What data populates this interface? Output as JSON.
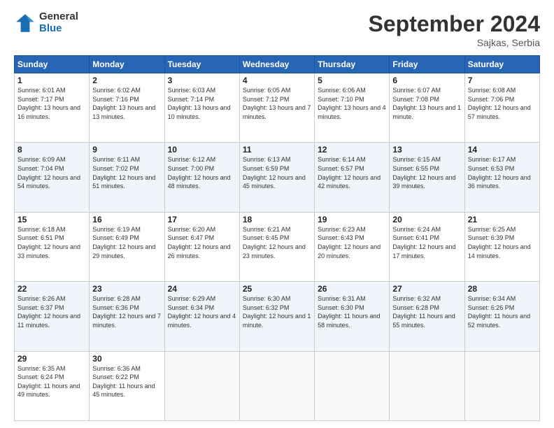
{
  "logo": {
    "general": "General",
    "blue": "Blue"
  },
  "header": {
    "month": "September 2024",
    "location": "Sajkas, Serbia"
  },
  "weekdays": [
    "Sunday",
    "Monday",
    "Tuesday",
    "Wednesday",
    "Thursday",
    "Friday",
    "Saturday"
  ],
  "weeks": [
    [
      {
        "day": "1",
        "sunrise": "6:01 AM",
        "sunset": "7:17 PM",
        "daylight": "13 hours and 16 minutes."
      },
      {
        "day": "2",
        "sunrise": "6:02 AM",
        "sunset": "7:16 PM",
        "daylight": "13 hours and 13 minutes."
      },
      {
        "day": "3",
        "sunrise": "6:03 AM",
        "sunset": "7:14 PM",
        "daylight": "13 hours and 10 minutes."
      },
      {
        "day": "4",
        "sunrise": "6:05 AM",
        "sunset": "7:12 PM",
        "daylight": "13 hours and 7 minutes."
      },
      {
        "day": "5",
        "sunrise": "6:06 AM",
        "sunset": "7:10 PM",
        "daylight": "13 hours and 4 minutes."
      },
      {
        "day": "6",
        "sunrise": "6:07 AM",
        "sunset": "7:08 PM",
        "daylight": "13 hours and 1 minute."
      },
      {
        "day": "7",
        "sunrise": "6:08 AM",
        "sunset": "7:06 PM",
        "daylight": "12 hours and 57 minutes."
      }
    ],
    [
      {
        "day": "8",
        "sunrise": "6:09 AM",
        "sunset": "7:04 PM",
        "daylight": "12 hours and 54 minutes."
      },
      {
        "day": "9",
        "sunrise": "6:11 AM",
        "sunset": "7:02 PM",
        "daylight": "12 hours and 51 minutes."
      },
      {
        "day": "10",
        "sunrise": "6:12 AM",
        "sunset": "7:00 PM",
        "daylight": "12 hours and 48 minutes."
      },
      {
        "day": "11",
        "sunrise": "6:13 AM",
        "sunset": "6:59 PM",
        "daylight": "12 hours and 45 minutes."
      },
      {
        "day": "12",
        "sunrise": "6:14 AM",
        "sunset": "6:57 PM",
        "daylight": "12 hours and 42 minutes."
      },
      {
        "day": "13",
        "sunrise": "6:15 AM",
        "sunset": "6:55 PM",
        "daylight": "12 hours and 39 minutes."
      },
      {
        "day": "14",
        "sunrise": "6:17 AM",
        "sunset": "6:53 PM",
        "daylight": "12 hours and 36 minutes."
      }
    ],
    [
      {
        "day": "15",
        "sunrise": "6:18 AM",
        "sunset": "6:51 PM",
        "daylight": "12 hours and 33 minutes."
      },
      {
        "day": "16",
        "sunrise": "6:19 AM",
        "sunset": "6:49 PM",
        "daylight": "12 hours and 29 minutes."
      },
      {
        "day": "17",
        "sunrise": "6:20 AM",
        "sunset": "6:47 PM",
        "daylight": "12 hours and 26 minutes."
      },
      {
        "day": "18",
        "sunrise": "6:21 AM",
        "sunset": "6:45 PM",
        "daylight": "12 hours and 23 minutes."
      },
      {
        "day": "19",
        "sunrise": "6:23 AM",
        "sunset": "6:43 PM",
        "daylight": "12 hours and 20 minutes."
      },
      {
        "day": "20",
        "sunrise": "6:24 AM",
        "sunset": "6:41 PM",
        "daylight": "12 hours and 17 minutes."
      },
      {
        "day": "21",
        "sunrise": "6:25 AM",
        "sunset": "6:39 PM",
        "daylight": "12 hours and 14 minutes."
      }
    ],
    [
      {
        "day": "22",
        "sunrise": "6:26 AM",
        "sunset": "6:37 PM",
        "daylight": "12 hours and 11 minutes."
      },
      {
        "day": "23",
        "sunrise": "6:28 AM",
        "sunset": "6:36 PM",
        "daylight": "12 hours and 7 minutes."
      },
      {
        "day": "24",
        "sunrise": "6:29 AM",
        "sunset": "6:34 PM",
        "daylight": "12 hours and 4 minutes."
      },
      {
        "day": "25",
        "sunrise": "6:30 AM",
        "sunset": "6:32 PM",
        "daylight": "12 hours and 1 minute."
      },
      {
        "day": "26",
        "sunrise": "6:31 AM",
        "sunset": "6:30 PM",
        "daylight": "11 hours and 58 minutes."
      },
      {
        "day": "27",
        "sunrise": "6:32 AM",
        "sunset": "6:28 PM",
        "daylight": "11 hours and 55 minutes."
      },
      {
        "day": "28",
        "sunrise": "6:34 AM",
        "sunset": "6:26 PM",
        "daylight": "11 hours and 52 minutes."
      }
    ],
    [
      {
        "day": "29",
        "sunrise": "6:35 AM",
        "sunset": "6:24 PM",
        "daylight": "11 hours and 49 minutes."
      },
      {
        "day": "30",
        "sunrise": "6:36 AM",
        "sunset": "6:22 PM",
        "daylight": "11 hours and 45 minutes."
      },
      null,
      null,
      null,
      null,
      null
    ]
  ]
}
